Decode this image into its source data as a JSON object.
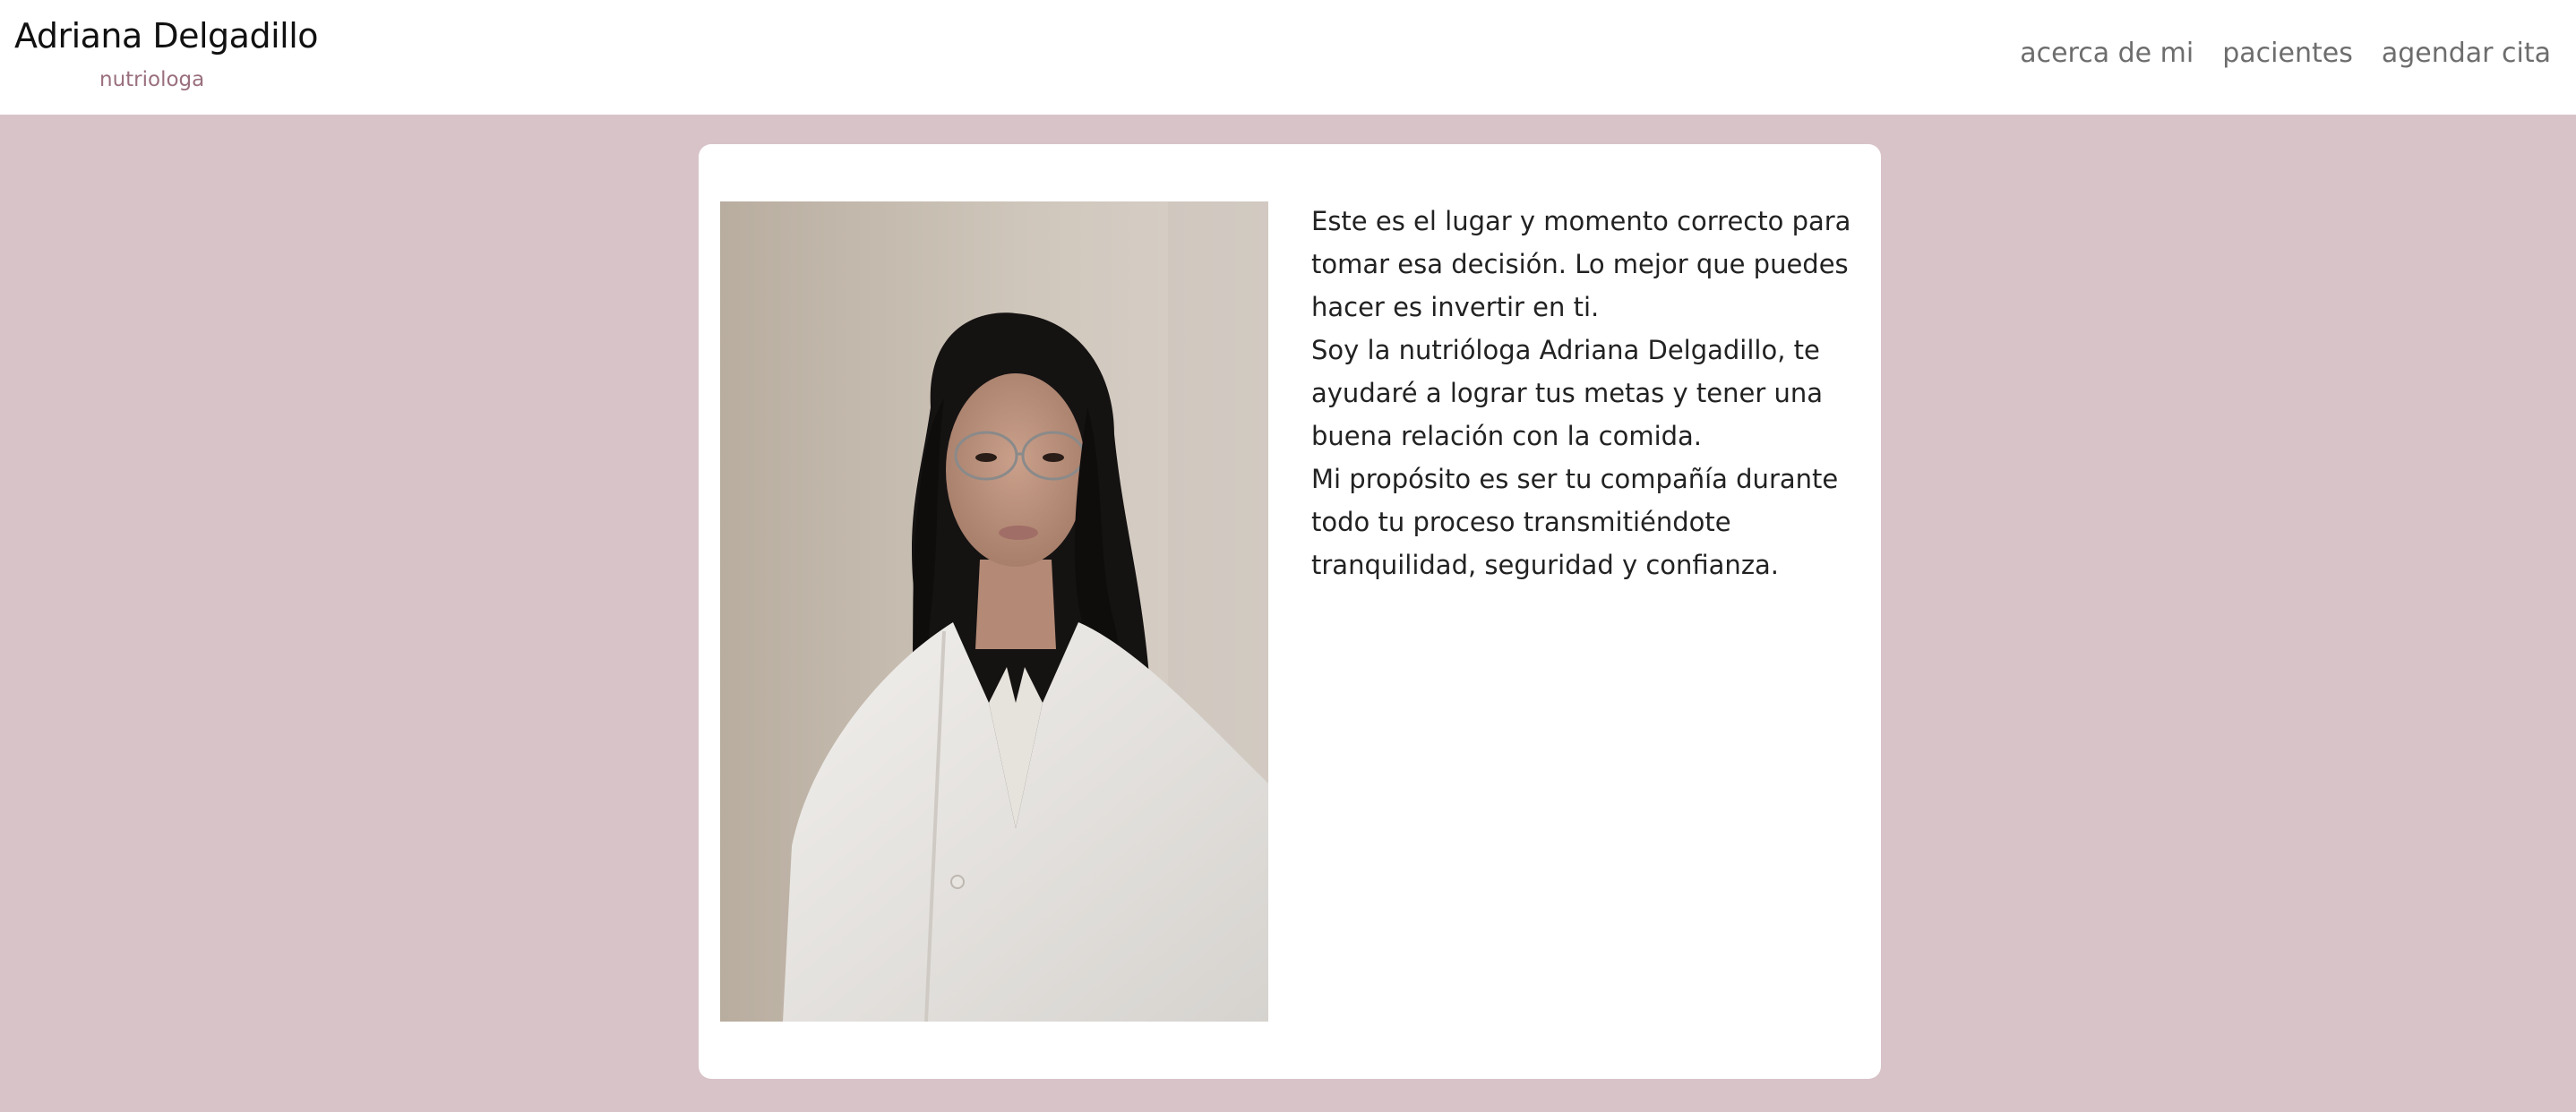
{
  "header": {
    "name": "Adriana Delgadillo",
    "subtitle": "nutriologa"
  },
  "nav": {
    "items": [
      {
        "label": "acerca de mi"
      },
      {
        "label": "pacientes"
      },
      {
        "label": "agendar cita"
      }
    ]
  },
  "about": {
    "paragraphs": [
      "Este es el lugar y momento correcto para tomar esa decisión. Lo mejor que puedes hacer es invertir en ti.",
      "Soy la nutrióloga Adriana Delgadillo, te ayudaré a lograr tus metas y tener una buena relación con la comida.",
      "Mi propósito es ser tu compañía durante todo tu proceso transmitiéndote tranquilidad, seguridad y confianza."
    ]
  },
  "colors": {
    "page_background": "#d8c3c8",
    "subtitle_accent": "#9a6f7e",
    "card_background": "#ffffff"
  }
}
